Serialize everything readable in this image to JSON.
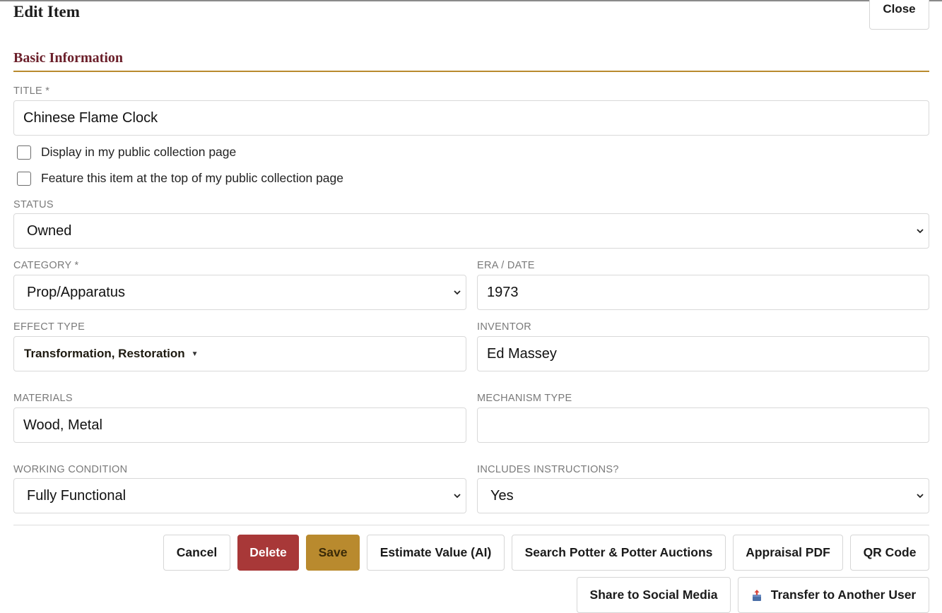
{
  "header": {
    "title": "Edit Item",
    "close_label": "Close"
  },
  "section": {
    "title": "Basic Information"
  },
  "form": {
    "title_label": "TITLE *",
    "title_value": "Chinese Flame Clock",
    "checkbox_public_label": "Display in my public collection page",
    "checkbox_public_checked": false,
    "checkbox_feature_label": "Feature this item at the top of my public collection page",
    "checkbox_feature_checked": false,
    "status_label": "STATUS",
    "status_value": "Owned",
    "category_label": "CATEGORY *",
    "category_value": "Prop/Apparatus",
    "era_label": "ERA / DATE",
    "era_value": "1973",
    "effect_label": "EFFECT TYPE",
    "effect_value": "Transformation, Restoration",
    "inventor_label": "INVENTOR",
    "inventor_value": "Ed Massey",
    "materials_label": "MATERIALS",
    "materials_value": "Wood, Metal",
    "mechanism_label": "MECHANISM TYPE",
    "mechanism_value": "",
    "condition_label": "WORKING CONDITION",
    "condition_value": "Fully Functional",
    "instructions_label": "INCLUDES INSTRUCTIONS?",
    "instructions_value": "Yes"
  },
  "actions": {
    "cancel": "Cancel",
    "delete": "Delete",
    "save": "Save",
    "estimate": "Estimate Value (AI)",
    "search_potter": "Search Potter & Potter Auctions",
    "appraisal_pdf": "Appraisal PDF",
    "qr_code": "QR Code",
    "share": "Share to Social Media",
    "transfer": "Transfer to Another User"
  },
  "icons": {
    "select_chevron": "chevron-down-icon",
    "effect_caret": "caret-down-icon",
    "transfer": "transfer-box-icon"
  },
  "colors": {
    "section_title": "#6b1f2a",
    "section_rule": "#b98a2e",
    "delete_button": "#a83838",
    "save_button": "#b98a2e"
  }
}
